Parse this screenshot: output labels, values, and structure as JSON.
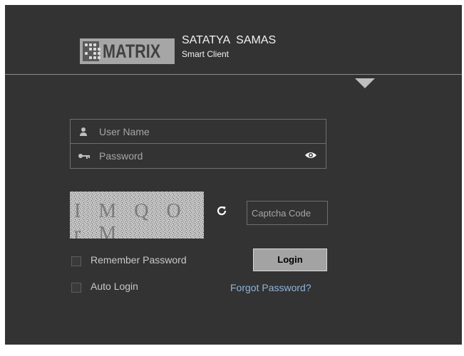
{
  "brand": {
    "logo_text": "MATRIX",
    "product_name": "SATATYA  SAMAS",
    "product_subtitle": "Smart Client"
  },
  "form": {
    "username": {
      "placeholder": "User Name",
      "value": ""
    },
    "password": {
      "placeholder": "Password",
      "value": ""
    },
    "captcha": {
      "image_text": "I M Q O r M",
      "placeholder": "Captcha Code",
      "value": ""
    },
    "remember_password": {
      "label": "Remember Password",
      "checked": false
    },
    "auto_login": {
      "label": "Auto Login",
      "checked": false
    },
    "login_label": "Login",
    "forgot_label": "Forgot Password?"
  },
  "icons": {
    "logo": "matrix-dots-logo-icon",
    "user": "user-icon",
    "password": "key-icon",
    "show_password": "eye-icon",
    "refresh": "refresh-icon",
    "expand": "triangle-down-icon"
  },
  "colors": {
    "background": "#333333",
    "button": "#a3a3a3",
    "link": "#8fb4d9",
    "border": "#6e6e6e"
  }
}
